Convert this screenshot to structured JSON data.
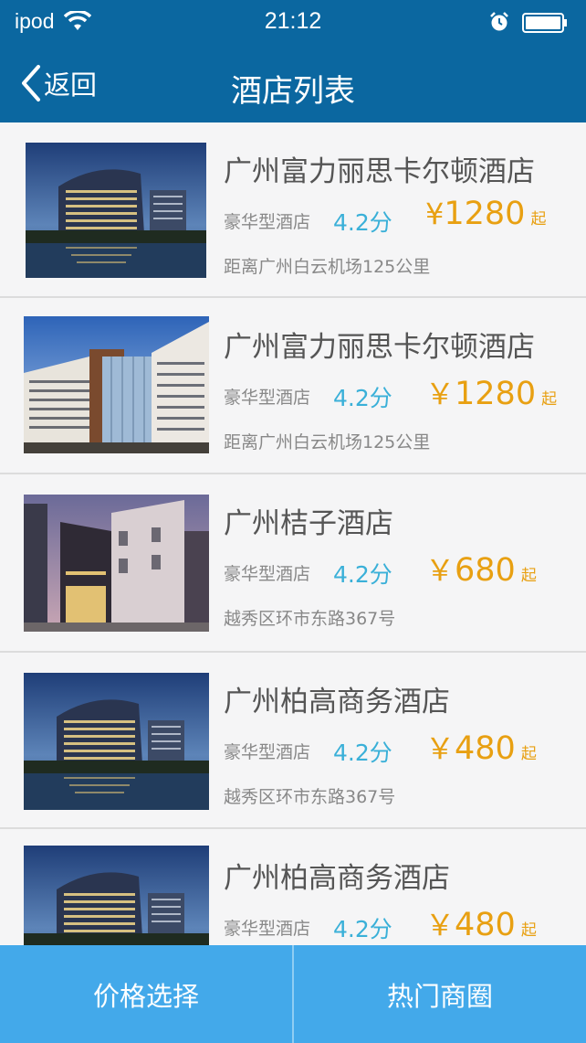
{
  "status_bar": {
    "carrier": "ipod",
    "time": "21:12"
  },
  "nav": {
    "back_label": "返回",
    "title": "酒店列表"
  },
  "hotels": [
    {
      "name": "广州富力丽思卡尔顿酒店",
      "type": "豪华型酒店",
      "score": "4.2分",
      "price_symbol": "¥",
      "price": "1280",
      "price_suffix": "起",
      "address": "距离广州白云机场125公里"
    },
    {
      "name": "广州富力丽思卡尔顿酒店",
      "type": "豪华型酒店",
      "score": "4.2分",
      "price_symbol": "￥",
      "price": "1280",
      "price_suffix": "起",
      "address": "距离广州白云机场125公里"
    },
    {
      "name": "广州桔子酒店",
      "type": "豪华型酒店",
      "score": "4.2分",
      "price_symbol": "￥",
      "price": "680",
      "price_suffix": "起",
      "address": "越秀区环市东路367号"
    },
    {
      "name": "广州柏高商务酒店",
      "type": "豪华型酒店",
      "score": "4.2分",
      "price_symbol": "￥",
      "price": "480",
      "price_suffix": "起",
      "address": "越秀区环市东路367号"
    },
    {
      "name": "广州柏高商务酒店",
      "type": "豪华型酒店",
      "score": "4.2分",
      "price_symbol": "￥",
      "price": "480",
      "price_suffix": "起",
      "address": ""
    }
  ],
  "bottom_bar": {
    "price_filter_label": "价格选择",
    "hot_area_label": "热门商圈"
  },
  "colors": {
    "header": "#0b67a0",
    "score": "#3ab0d8",
    "price": "#e8a012",
    "bottom_bar": "#43a9ea"
  }
}
